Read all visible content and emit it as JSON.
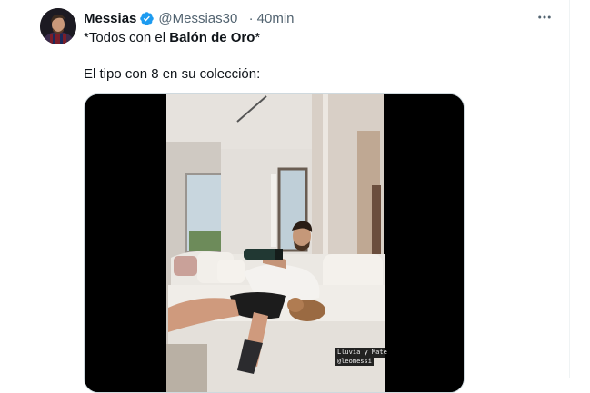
{
  "tweet": {
    "display_name": "Messias",
    "handle": "@Messias30_",
    "separator": "·",
    "time": "40min",
    "text_prefix": "*Todos con el ",
    "text_bold": "Balón de Oro",
    "text_suffix": "*",
    "text_line2": "El tipo con 8 en su colección:",
    "video_caption_line1": "Lluvia y Mate",
    "video_caption_line2": "@leomessi"
  },
  "icons": {
    "verified": "verified-badge-icon",
    "more": "more-options-icon"
  },
  "colors": {
    "verified_blue": "#1d9bf0",
    "secondary_text": "#536471",
    "primary_text": "#0f1419",
    "border": "#eff3f4"
  }
}
